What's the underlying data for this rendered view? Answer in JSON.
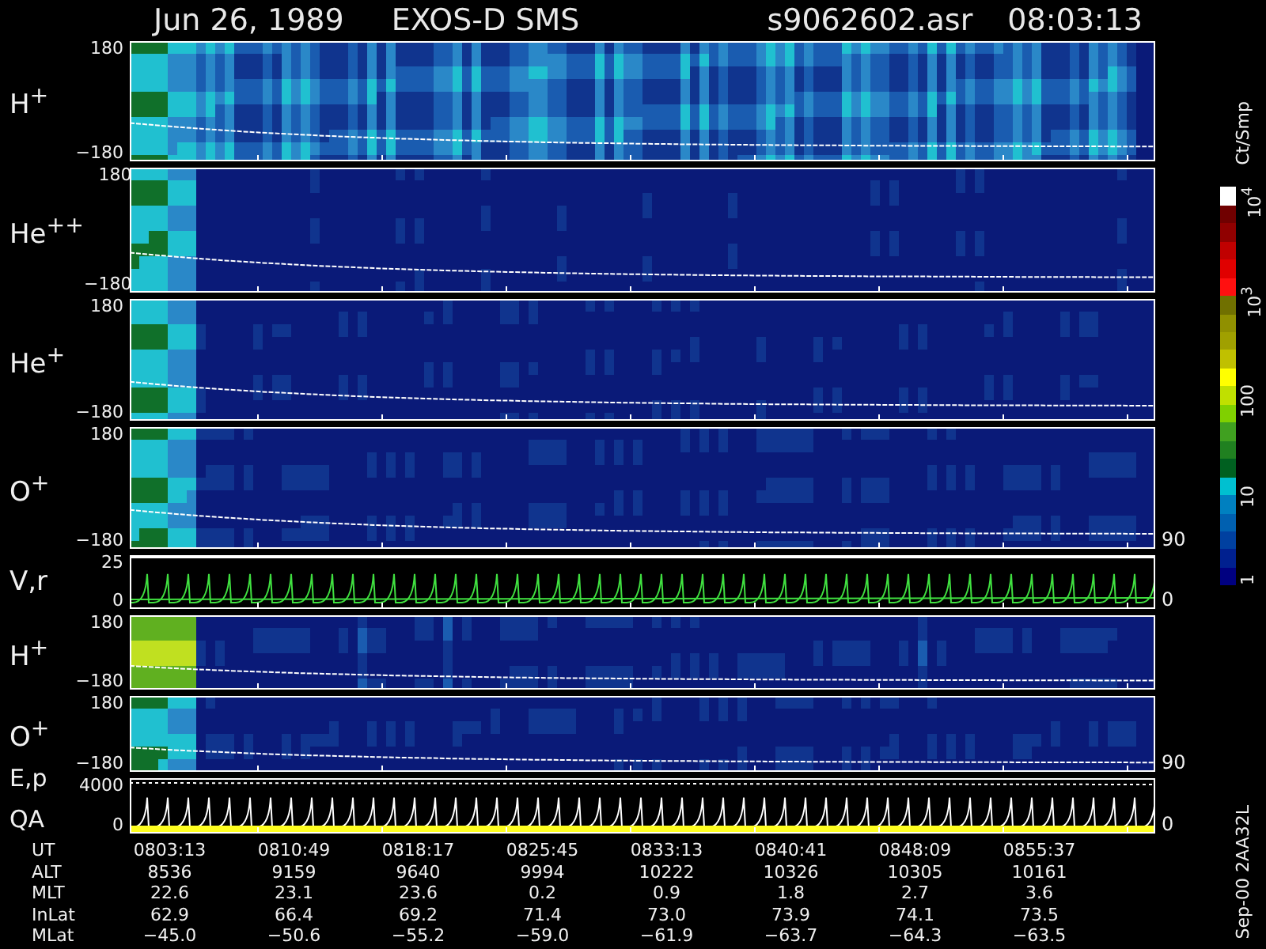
{
  "header": {
    "date": "Jun 26, 1989",
    "instrument": "EXOS-D SMS",
    "file": "s9062602.asr",
    "time": "08:03:13"
  },
  "panels": [
    {
      "kind": "spectrogram",
      "labels": [
        "H$^{+}$"
      ],
      "y_ticks": [
        "180",
        "−180"
      ]
    },
    {
      "kind": "spectrogram",
      "labels": [
        "He$^{++}$"
      ],
      "y_ticks": [
        "180",
        "−180"
      ]
    },
    {
      "kind": "spectrogram",
      "labels": [
        "He$^{+}$"
      ],
      "y_ticks": [
        "180",
        "−180"
      ]
    },
    {
      "kind": "spectrogram",
      "labels": [
        "O$^{+}$"
      ],
      "y_ticks": [
        "180",
        "−180"
      ],
      "right_ticks": [
        "90"
      ]
    },
    {
      "kind": "velocity_trace",
      "labels": [
        "V,r"
      ],
      "y_ticks": [
        "25",
        "0"
      ],
      "right_ticks": [
        "0"
      ]
    },
    {
      "kind": "spectrogram",
      "labels": [
        "H$^{+}$"
      ],
      "y_ticks": [
        "180",
        "−180"
      ]
    },
    {
      "kind": "spectrogram",
      "labels": [
        "O$^{+}$"
      ],
      "y_ticks": [
        "180",
        "−180"
      ],
      "right_ticks": [
        "90"
      ]
    },
    {
      "kind": "energy_trace",
      "labels": [
        "E,p",
        "QA"
      ],
      "y_ticks": [
        "4000",
        "0"
      ],
      "right_ticks": [
        "0"
      ]
    }
  ],
  "colorbar": {
    "unit": "Ct/Smp",
    "ticks": [
      "10$^{4}$",
      "10$^{3}$",
      "100",
      "10",
      "1"
    ]
  },
  "ephemeris": [
    {
      "label": "UT",
      "values": [
        "0803:13",
        "0810:49",
        "0818:17",
        "0825:45",
        "0833:13",
        "0840:41",
        "0848:09",
        "0855:37"
      ]
    },
    {
      "label": "ALT",
      "values": [
        "8536",
        "9159",
        "9640",
        "9994",
        "10222",
        "10326",
        "10305",
        "10161"
      ]
    },
    {
      "label": "MLT",
      "values": [
        "22.6",
        "23.1",
        "23.6",
        "0.2",
        "0.9",
        "1.8",
        "2.7",
        "3.6"
      ]
    },
    {
      "label": "InLat",
      "values": [
        "62.9",
        "66.4",
        "69.2",
        "71.4",
        "73.0",
        "73.9",
        "74.1",
        "73.5"
      ]
    },
    {
      "label": "MLat",
      "values": [
        "−45.0",
        "−50.6",
        "−55.2",
        "−59.0",
        "−61.9",
        "−63.7",
        "−64.3",
        "−63.5"
      ]
    }
  ],
  "footer_code": "Sep-00 2AA32L"
}
